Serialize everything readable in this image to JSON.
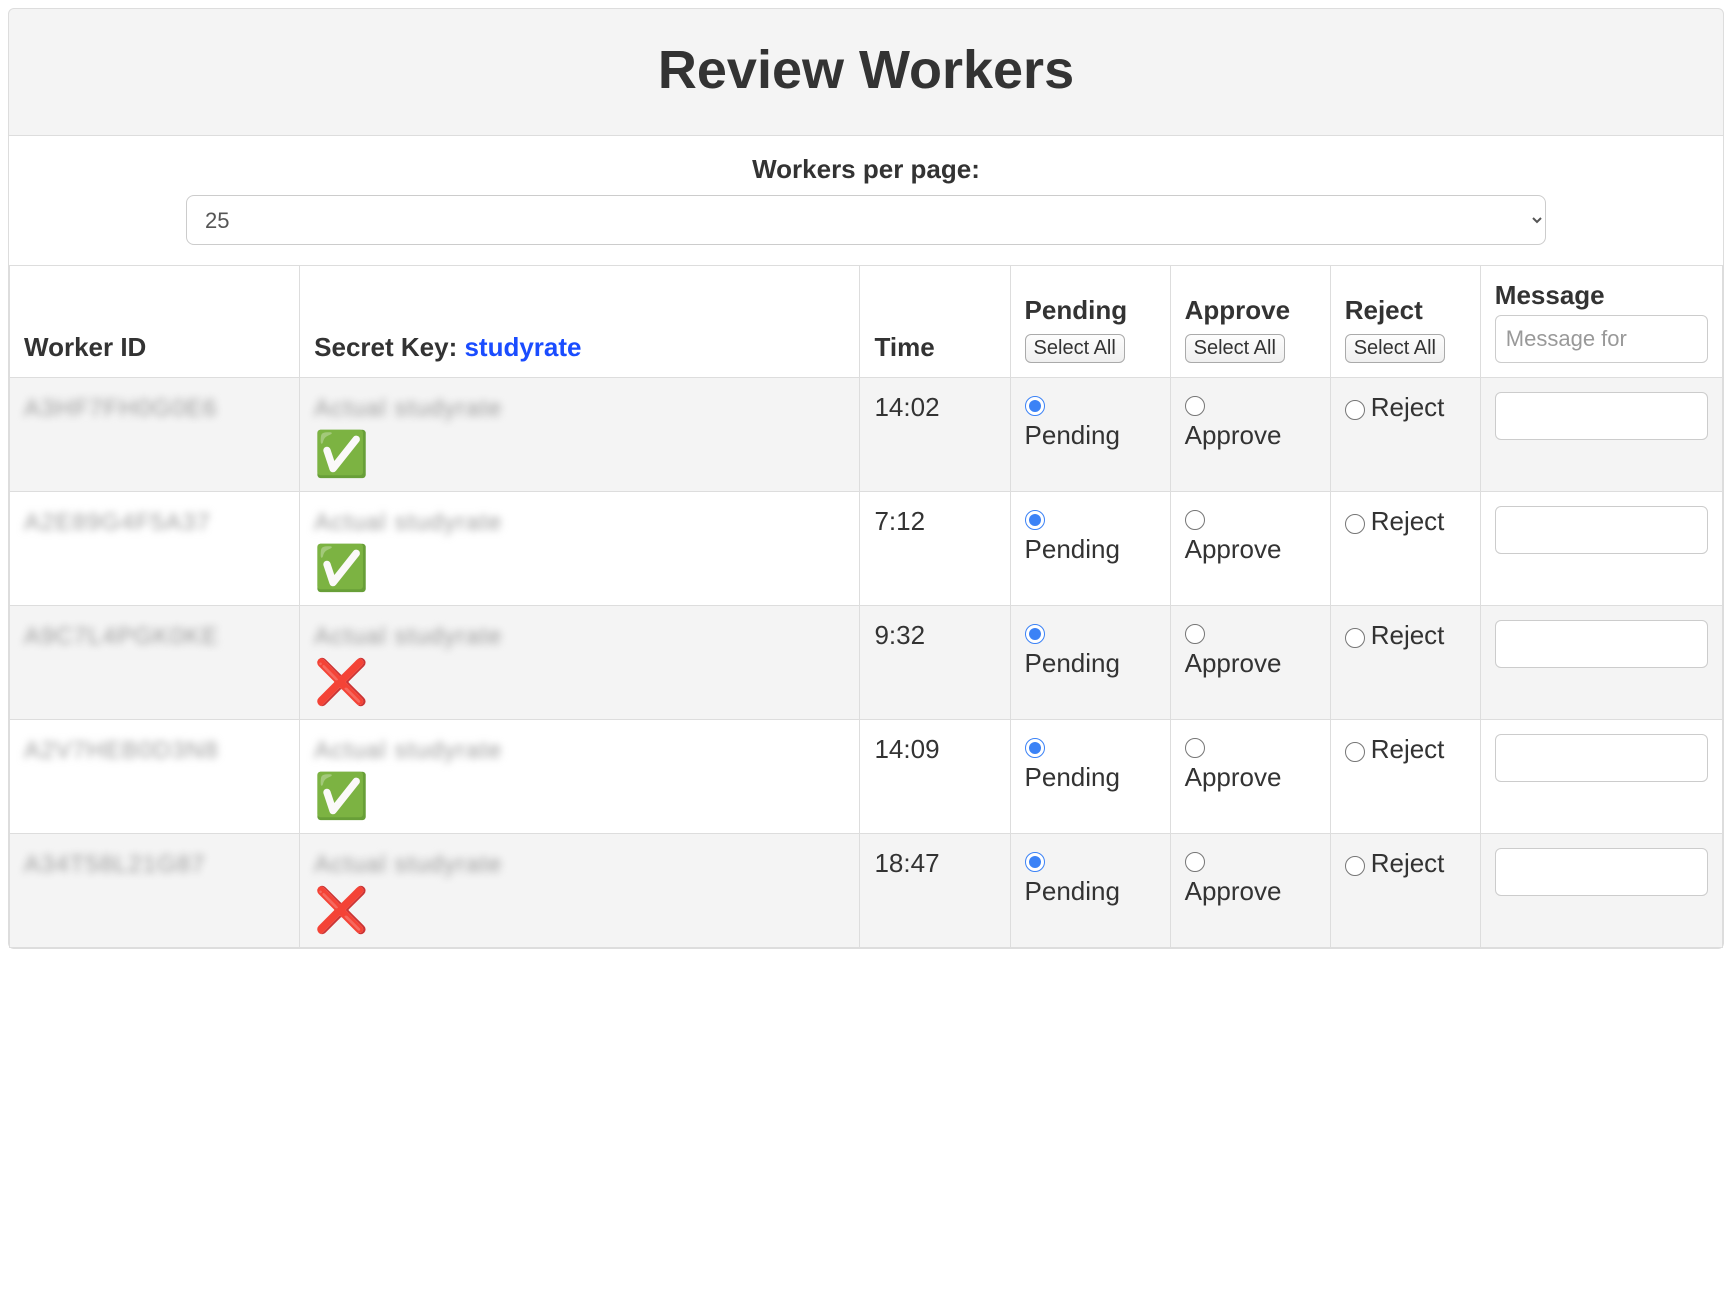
{
  "header": {
    "title": "Review Workers"
  },
  "per_page": {
    "label": "Workers per page:",
    "selected": "25"
  },
  "table": {
    "headers": {
      "worker_id": "Worker ID",
      "secret_key_label": "Secret Key: ",
      "secret_key_value": "studyrate",
      "time": "Time",
      "pending": "Pending",
      "approve": "Approve",
      "reject": "Reject",
      "message": "Message",
      "select_all": "Select All",
      "message_placeholder": "Message for"
    },
    "radio_labels": {
      "pending": "Pending",
      "approve": "Approve",
      "reject": "Reject"
    },
    "status_glyphs": {
      "match": "✅",
      "mismatch": "❌"
    },
    "rows": [
      {
        "worker_id": "A3HF7FH0G0E6",
        "secret_entry": "Actual studyrate",
        "time": "14:02",
        "match": true,
        "selection": "pending",
        "message": ""
      },
      {
        "worker_id": "A2E89G4F5A37",
        "secret_entry": "Actual studyrate",
        "time": "7:12",
        "match": true,
        "selection": "pending",
        "message": ""
      },
      {
        "worker_id": "A9C7L4PGK0KE",
        "secret_entry": "Actual studyrate",
        "time": "9:32",
        "match": false,
        "selection": "pending",
        "message": ""
      },
      {
        "worker_id": "A2V7HEB0D3N8",
        "secret_entry": "Actual studyrate",
        "time": "14:09",
        "match": true,
        "selection": "pending",
        "message": ""
      },
      {
        "worker_id": "A34T58L21G87",
        "secret_entry": "Actual studyrate",
        "time": "18:47",
        "match": false,
        "selection": "pending",
        "message": ""
      }
    ]
  }
}
